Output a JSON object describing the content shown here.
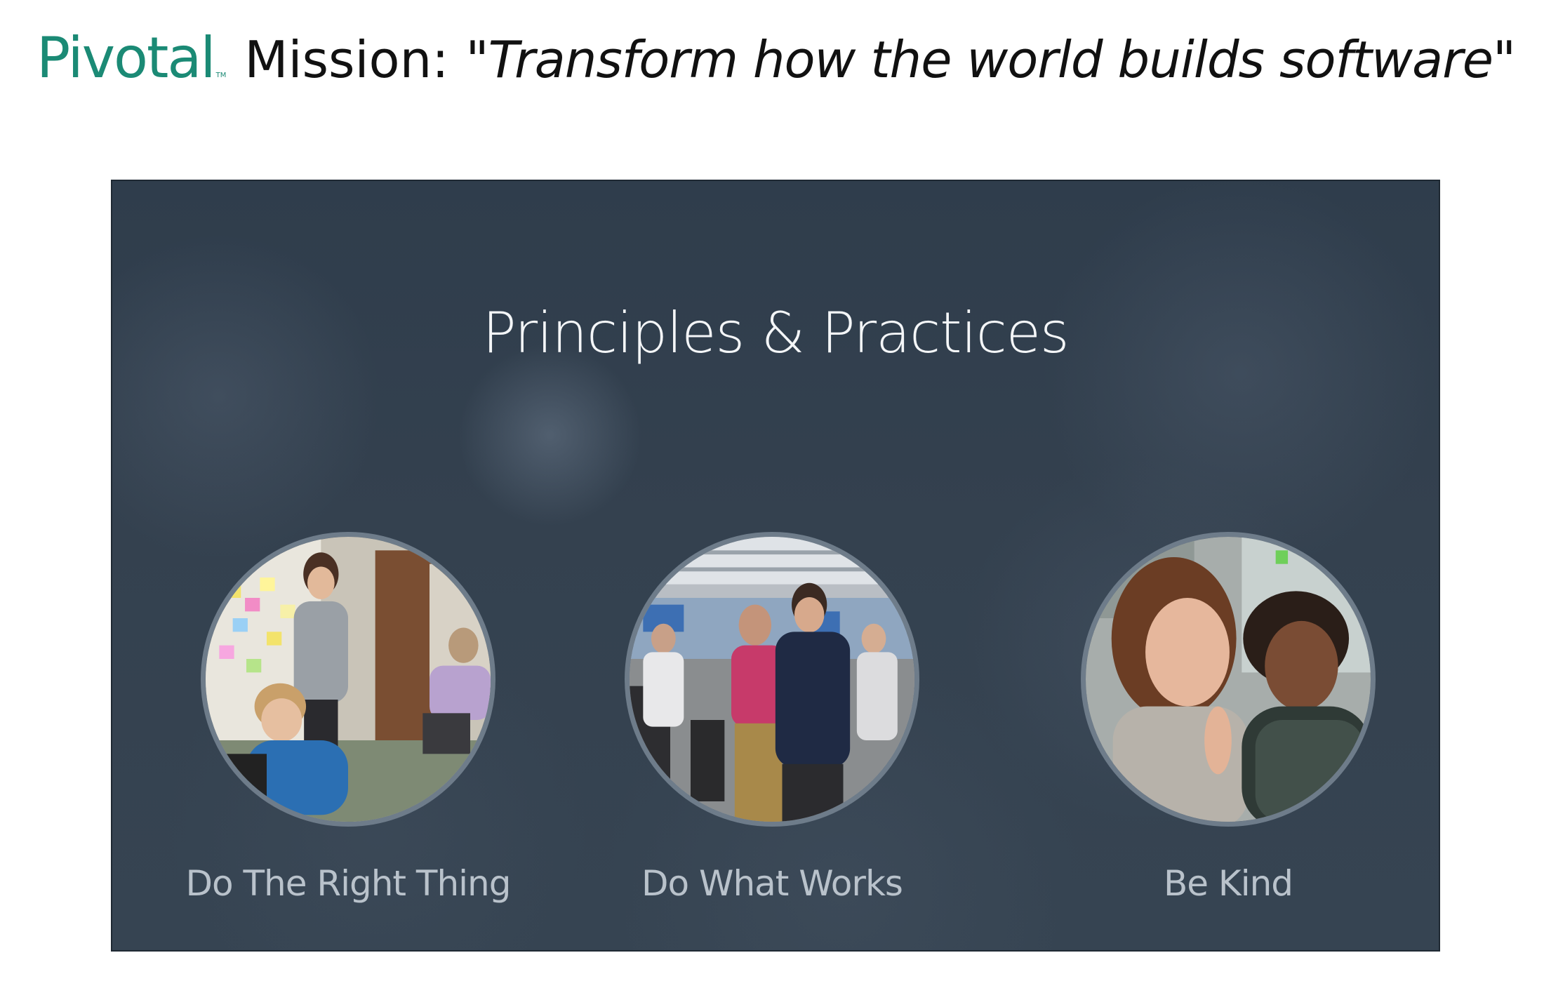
{
  "header": {
    "logo_text": "Pivotal",
    "logo_tm": "TM",
    "mission_label": "Mission:",
    "mission_quote": "\"Transform how the world builds software\""
  },
  "colors": {
    "brand": "#1b8a75",
    "panel_bg": "#33414f",
    "circle_border": "#6e7c8a",
    "label_text": "#b9c2cb"
  },
  "panel": {
    "title": "Principles & Practices",
    "principles": [
      {
        "label": "Do The Right Thing",
        "image": "team-meeting-photo"
      },
      {
        "label": "Do What Works",
        "image": "office-conversation-photo"
      },
      {
        "label": "Be Kind",
        "image": "two-women-smiling-photo"
      }
    ]
  }
}
